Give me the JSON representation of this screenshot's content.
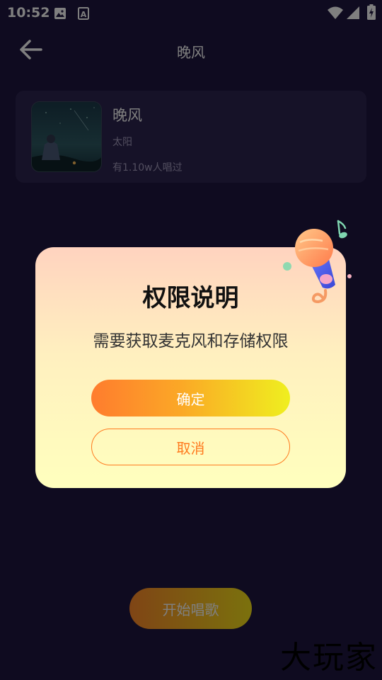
{
  "status_bar": {
    "time": "10:52",
    "icons": [
      "image-icon",
      "a-icon",
      "wifi-icon",
      "signal-icon",
      "battery-icon"
    ]
  },
  "header": {
    "title": "晚风",
    "back_icon": "arrow-left-icon"
  },
  "song": {
    "name": "晚风",
    "artist": "太阳",
    "sung_count": "有1.10w人唱过"
  },
  "start_button": {
    "label": "开始唱歌"
  },
  "dialog": {
    "title": "权限说明",
    "message": "需要获取麦克风和存储权限",
    "confirm_label": "确定",
    "cancel_label": "取消",
    "decoration_icon": "microphone-icon"
  },
  "watermark": {
    "text": "大玩家"
  },
  "colors": {
    "background": "#1e1640",
    "accent_orange": "#ff7a1e",
    "accent_yellow": "#efef1f"
  }
}
